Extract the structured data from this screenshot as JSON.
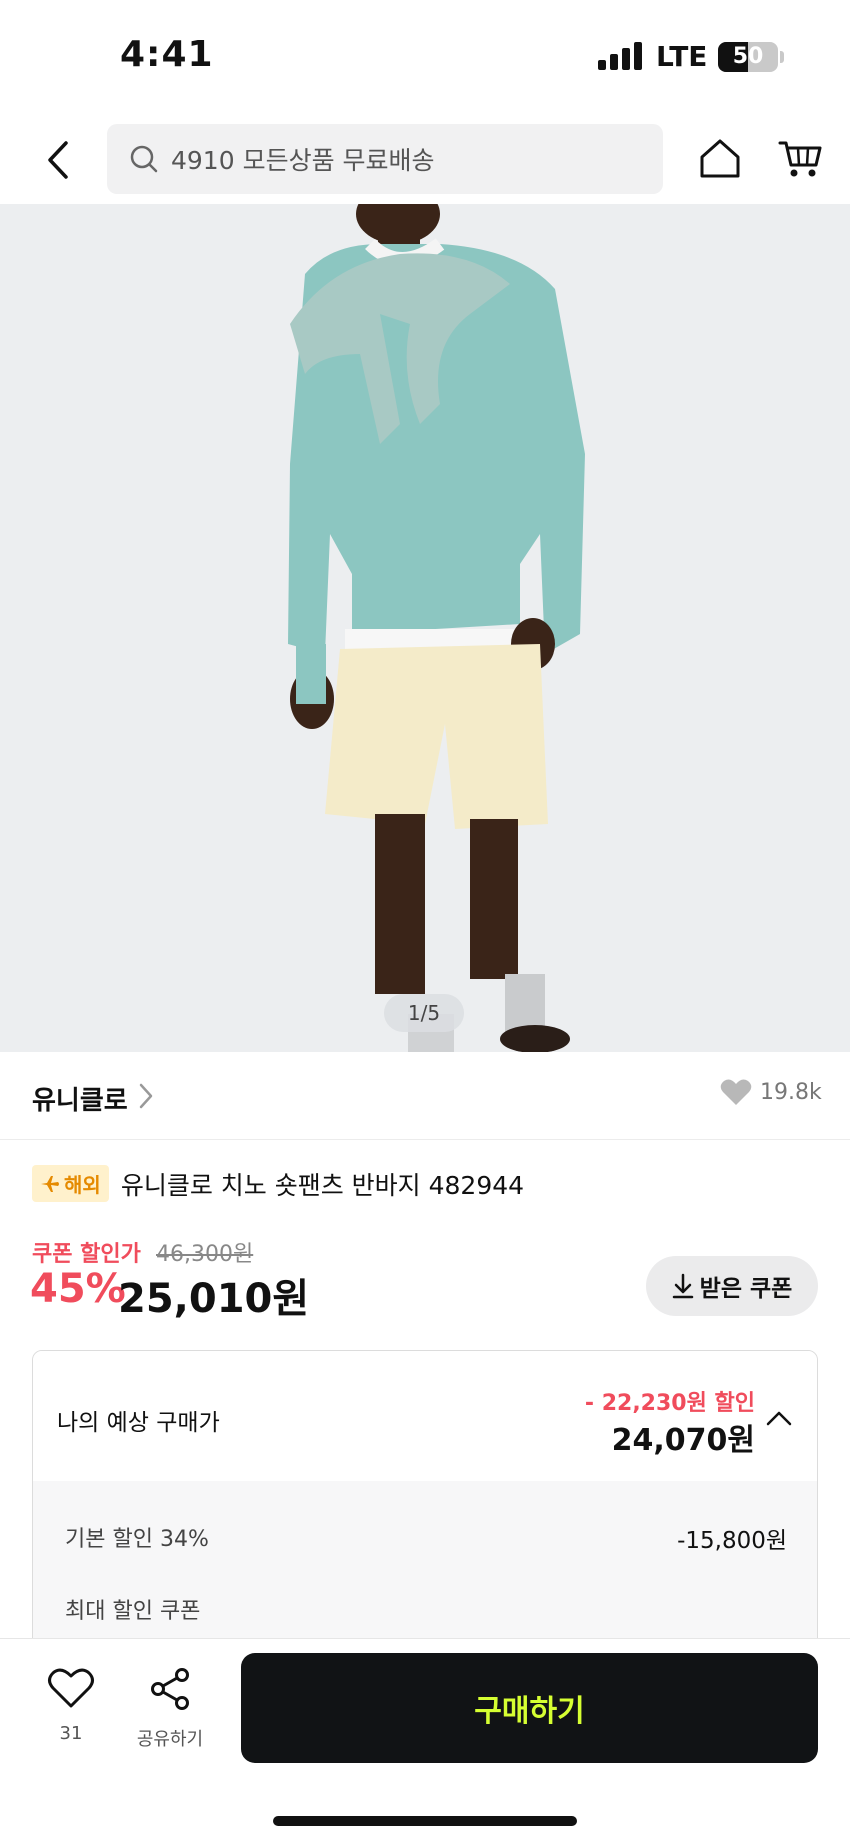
{
  "status_bar": {
    "time": "4:41",
    "network": "LTE",
    "battery": "50",
    "battery_level": 0.5
  },
  "nav": {
    "search_placeholder": "4910 모든상품 무료배송",
    "icons": [
      "back-chevron-icon",
      "search-icon",
      "home-icon",
      "cart-icon"
    ]
  },
  "gallery": {
    "counter": "1/5"
  },
  "brand": {
    "name": "유니클로",
    "likes": "19.8k"
  },
  "product": {
    "badge": "해외",
    "title": "유니클로 치노 숏팬츠 반바지 482944",
    "coupon_label": "쿠폰 할인가",
    "original_price": "46,300원",
    "discount_rate": "45%",
    "sale_price": "25,010원",
    "coupon_button": "받은 쿠폰"
  },
  "expected_price": {
    "label": "나의 예상 구매가",
    "discount": "- 22,230원 할인",
    "price": "24,070원",
    "rows": [
      {
        "label": "기본 할인 34%",
        "value": "-15,800원"
      },
      {
        "label": "최대 할인 쿠폰",
        "value": ""
      }
    ]
  },
  "bottom_bar": {
    "wish_count": "31",
    "share_label": "공유하기",
    "buy_label": "구매하기"
  },
  "colors": {
    "accent_red": "#f04c5c",
    "buy_button_bg": "#111315",
    "buy_button_text": "#d6ff32",
    "badge_bg": "#fff1cc",
    "badge_text": "#e58a00"
  }
}
